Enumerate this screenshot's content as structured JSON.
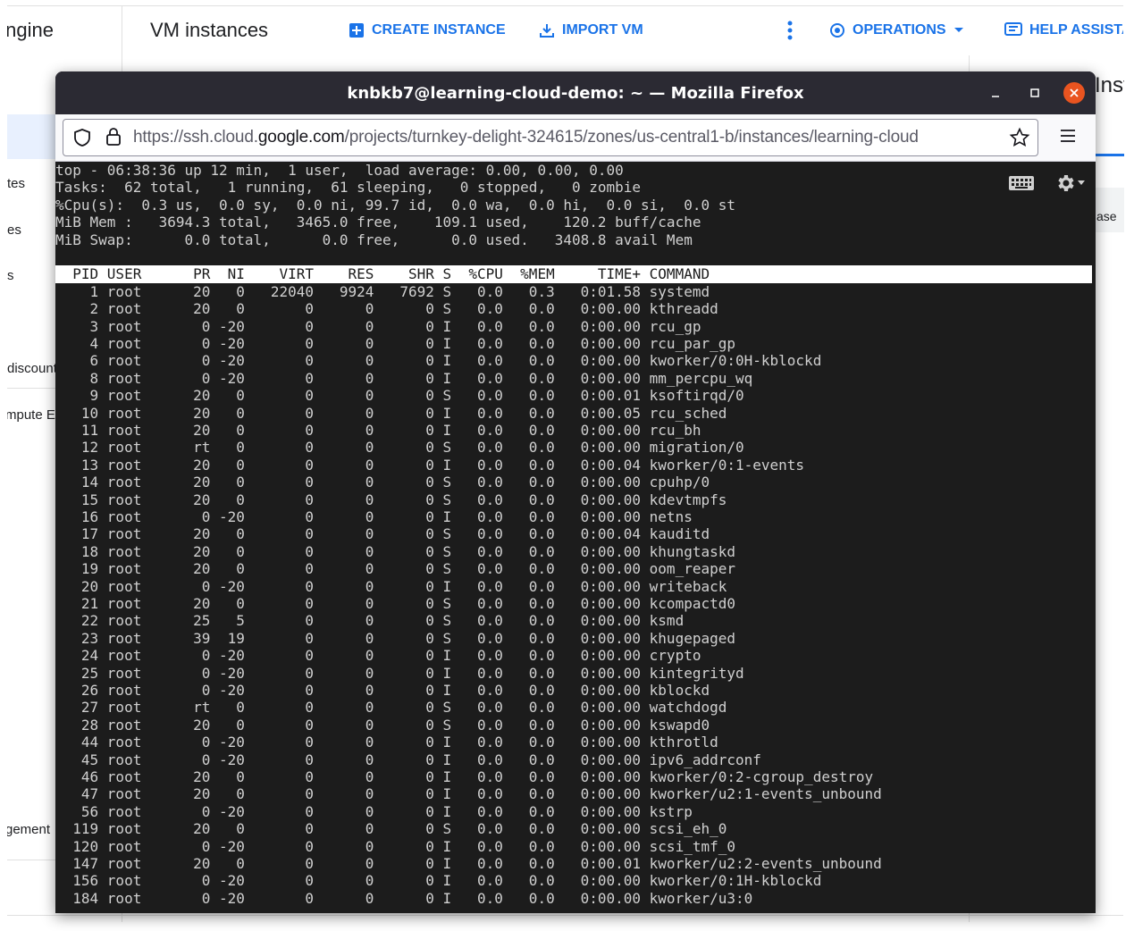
{
  "console": {
    "product_name": "Compute Engine",
    "page_title": "VM instances",
    "actions": [
      {
        "label": "CREATE INSTANCE",
        "icon": "add-box-icon"
      },
      {
        "label": "IMPORT VM",
        "icon": "download-icon"
      },
      {
        "label": "OPERATIONS",
        "icon": "operations-icon"
      },
      {
        "label": "HELP ASSISTANT",
        "icon": "help-assistant-icon"
      }
    ],
    "sidebar_fragments": [
      "tes",
      "es",
      "s",
      "discounts",
      "mpute Engine",
      "gement"
    ],
    "right_panel_title": "Inst",
    "right_panel_fragment": "ase",
    "colors": {
      "accent": "#1a73e8",
      "selected_bg": "#e8f0fe"
    }
  },
  "firefox": {
    "window_title": "knbkb7@learning-cloud-demo: ~ — Mozilla Firefox",
    "url_prefix": "https://ssh.cloud.",
    "url_domain": "google.com",
    "url_path": "/projects/turnkey-delight-324615/zones/us-central1-b/instances/learning-cloud",
    "titlebar_color": "#2b2a33",
    "close_color": "#e95420"
  },
  "terminal": {
    "summary": [
      "top - 06:38:36 up 12 min,  1 user,  load average: 0.00, 0.00, 0.00",
      "Tasks:  62 total,   1 running,  61 sleeping,   0 stopped,   0 zombie",
      "%Cpu(s):  0.3 us,  0.0 sy,  0.0 ni, 99.7 id,  0.0 wa,  0.0 hi,  0.0 si,  0.0 st",
      "MiB Mem :   3694.3 total,   3465.0 free,    109.1 used,    120.2 buff/cache",
      "MiB Swap:      0.0 total,      0.0 free,      0.0 used.   3408.8 avail Mem"
    ],
    "header": "  PID USER      PR  NI    VIRT    RES    SHR S  %CPU  %MEM     TIME+ COMMAND",
    "processes": [
      "    1 root      20   0   22040   9924   7692 S   0.0   0.3   0:01.58 systemd",
      "    2 root      20   0       0      0      0 S   0.0   0.0   0:00.00 kthreadd",
      "    3 root       0 -20       0      0      0 I   0.0   0.0   0:00.00 rcu_gp",
      "    4 root       0 -20       0      0      0 I   0.0   0.0   0:00.00 rcu_par_gp",
      "    6 root       0 -20       0      0      0 I   0.0   0.0   0:00.00 kworker/0:0H-kblockd",
      "    8 root       0 -20       0      0      0 I   0.0   0.0   0:00.00 mm_percpu_wq",
      "    9 root      20   0       0      0      0 S   0.0   0.0   0:00.01 ksoftirqd/0",
      "   10 root      20   0       0      0      0 I   0.0   0.0   0:00.05 rcu_sched",
      "   11 root      20   0       0      0      0 I   0.0   0.0   0:00.00 rcu_bh",
      "   12 root      rt   0       0      0      0 S   0.0   0.0   0:00.00 migration/0",
      "   13 root      20   0       0      0      0 I   0.0   0.0   0:00.04 kworker/0:1-events",
      "   14 root      20   0       0      0      0 S   0.0   0.0   0:00.00 cpuhp/0",
      "   15 root      20   0       0      0      0 S   0.0   0.0   0:00.00 kdevtmpfs",
      "   16 root       0 -20       0      0      0 I   0.0   0.0   0:00.00 netns",
      "   17 root      20   0       0      0      0 S   0.0   0.0   0:00.04 kauditd",
      "   18 root      20   0       0      0      0 S   0.0   0.0   0:00.00 khungtaskd",
      "   19 root      20   0       0      0      0 S   0.0   0.0   0:00.00 oom_reaper",
      "   20 root       0 -20       0      0      0 I   0.0   0.0   0:00.00 writeback",
      "   21 root      20   0       0      0      0 S   0.0   0.0   0:00.00 kcompactd0",
      "   22 root      25   5       0      0      0 S   0.0   0.0   0:00.00 ksmd",
      "   23 root      39  19       0      0      0 S   0.0   0.0   0:00.00 khugepaged",
      "   24 root       0 -20       0      0      0 I   0.0   0.0   0:00.00 crypto",
      "   25 root       0 -20       0      0      0 I   0.0   0.0   0:00.00 kintegrityd",
      "   26 root       0 -20       0      0      0 I   0.0   0.0   0:00.00 kblockd",
      "   27 root      rt   0       0      0      0 S   0.0   0.0   0:00.00 watchdogd",
      "   28 root      20   0       0      0      0 S   0.0   0.0   0:00.00 kswapd0",
      "   44 root       0 -20       0      0      0 I   0.0   0.0   0:00.00 kthrotld",
      "   45 root       0 -20       0      0      0 I   0.0   0.0   0:00.00 ipv6_addrconf",
      "   46 root      20   0       0      0      0 I   0.0   0.0   0:00.00 kworker/0:2-cgroup_destroy",
      "   47 root      20   0       0      0      0 I   0.0   0.0   0:00.00 kworker/u2:1-events_unbound",
      "   56 root       0 -20       0      0      0 I   0.0   0.0   0:00.00 kstrp",
      "  119 root      20   0       0      0      0 S   0.0   0.0   0:00.00 scsi_eh_0",
      "  120 root       0 -20       0      0      0 I   0.0   0.0   0:00.00 scsi_tmf_0",
      "  147 root      20   0       0      0      0 I   0.0   0.0   0:00.01 kworker/u2:2-events_unbound",
      "  156 root       0 -20       0      0      0 I   0.0   0.0   0:00.00 kworker/0:1H-kblockd",
      "  184 root       0 -20       0      0      0 I   0.0   0.0   0:00.00 kworker/u3:0"
    ],
    "bg": "#1c1c1c",
    "fg": "#d0d0d0"
  }
}
